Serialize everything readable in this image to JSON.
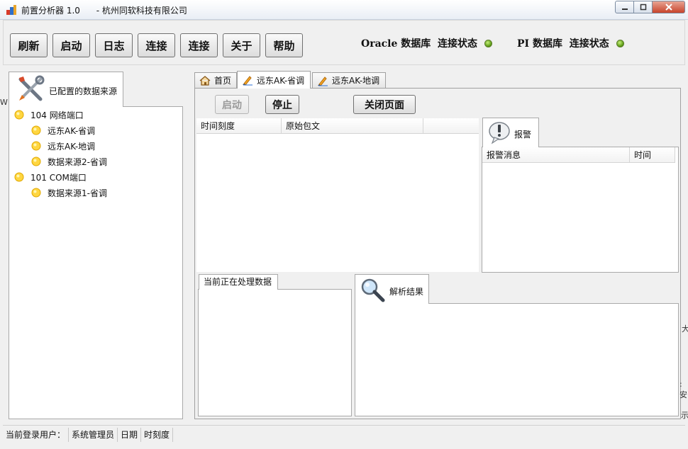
{
  "window": {
    "title": "前置分析器 1.0      - 杭州同软科技有限公司"
  },
  "toolbar": {
    "buttons": [
      "刷新",
      "启动",
      "日志",
      "连接",
      "连接",
      "关于",
      "帮助"
    ],
    "oracle_status_label": "Oracle 数据库  连接状态",
    "pi_status_label": "PI 数据库  连接状态",
    "status_colors": {
      "oracle": "#7ac143",
      "pi": "#7ac143"
    }
  },
  "left_panel": {
    "tab_label": "已配置的数据来源",
    "tree": [
      {
        "label": "104 网络端口",
        "level": 0
      },
      {
        "label": "远东AK-省调",
        "level": 1
      },
      {
        "label": "远东AK-地调",
        "level": 1
      },
      {
        "label": "数据来源2-省调",
        "level": 1
      },
      {
        "label": "101 COM端口",
        "level": 0
      },
      {
        "label": "数据来源1-省调",
        "level": 1
      }
    ]
  },
  "content_tabs": [
    {
      "label": "首页",
      "icon": "home-icon"
    },
    {
      "label": "远东AK-省调",
      "icon": "pencil-icon",
      "active": true
    },
    {
      "label": "远东AK-地调",
      "icon": "pencil-icon"
    }
  ],
  "actions": {
    "start": "启动",
    "stop": "停止",
    "close_page": "关闭页面"
  },
  "raw_table": {
    "columns": [
      "时间刻度",
      "原始包文",
      ""
    ]
  },
  "alarm": {
    "tab_label": "报警",
    "columns": [
      "报警消息",
      "时间"
    ]
  },
  "processing": {
    "tab_label": "当前正在处理数据"
  },
  "parse": {
    "tab_label": "解析结果"
  },
  "statusbar": {
    "login_label": "当前登录用户：",
    "user": "系统管理员",
    "date_label": "日期",
    "time_label": "时刻度"
  },
  "edge_fragments": [
    "W",
    "大",
    ":安",
    "示"
  ]
}
